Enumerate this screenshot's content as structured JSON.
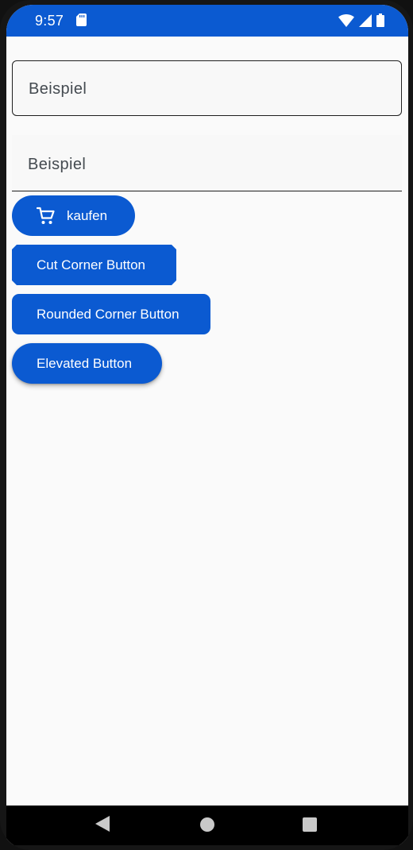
{
  "status_bar": {
    "time": "9:57",
    "background": "#0b5ad1",
    "icons": [
      "sd-card-icon",
      "wifi-icon",
      "signal-icon",
      "battery-icon"
    ]
  },
  "fields": {
    "outlined": {
      "value": "Beispiel"
    },
    "filled": {
      "value": "Beispiel"
    }
  },
  "buttons": {
    "kaufen": {
      "label": "kaufen",
      "icon": "shopping-cart-icon"
    },
    "cut_corner": {
      "label": "Cut Corner Button"
    },
    "rounded_corner": {
      "label": "Rounded Corner Button"
    },
    "elevated": {
      "label": "Elevated Button"
    }
  },
  "colors": {
    "primary": "#0b5ad1",
    "background": "#fafafa",
    "on_primary": "#ffffff"
  },
  "nav_bar": {
    "icons": [
      "back-icon",
      "home-icon",
      "recents-icon"
    ]
  }
}
